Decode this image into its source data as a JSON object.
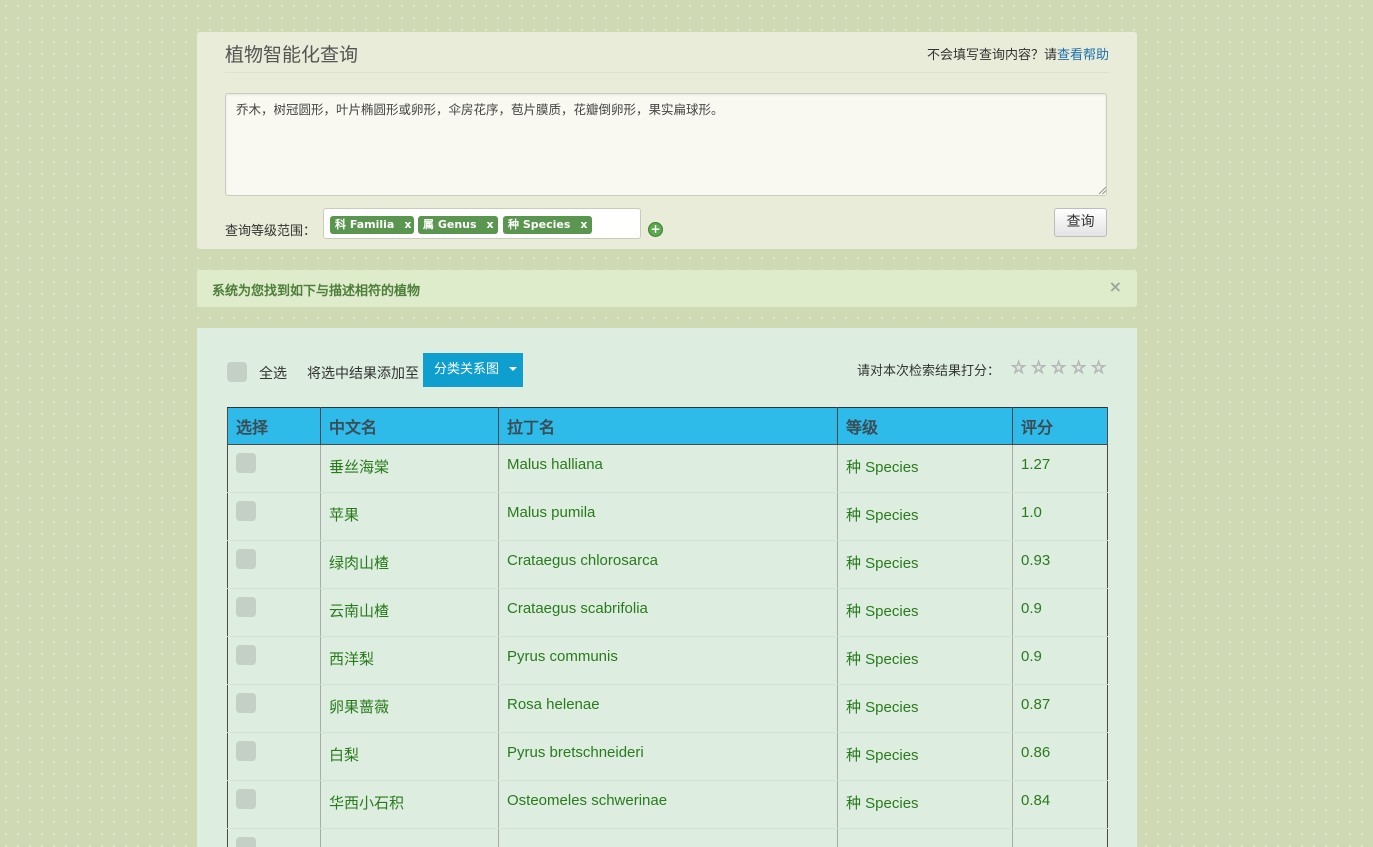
{
  "query": {
    "title": "植物智能化查询",
    "help_prefix": "不会填写查询内容？请",
    "help_link": "查看帮助",
    "description": "乔木，树冠圆形，叶片椭圆形或卵形，伞房花序，苞片膜质，花瓣倒卵形，果实扁球形。",
    "scope_label": "查询等级范围：",
    "tags": [
      {
        "label": "科 Familia",
        "remove": "x"
      },
      {
        "label": "属 Genus",
        "remove": "x"
      },
      {
        "label": "种 Species",
        "remove": "x"
      }
    ],
    "add_icon": "+",
    "submit_label": "查询"
  },
  "alert": {
    "text": "系统为您找到如下与描述相符的植物",
    "close": "×"
  },
  "results": {
    "select_all_label": "全选",
    "add_to_label": "将选中结果添加至",
    "dropdown_label": "分类关系图",
    "rate_label": "请对本次检索结果打分：",
    "stars": [
      "☆",
      "☆",
      "☆",
      "☆",
      "☆"
    ],
    "rating_value": 0,
    "columns": [
      "选择",
      "中文名",
      "拉丁名",
      "等级",
      "评分"
    ],
    "rows": [
      {
        "cn": "垂丝海棠",
        "latin": "Malus halliana",
        "rank": "种 Species",
        "score": "1.27"
      },
      {
        "cn": "苹果",
        "latin": "Malus pumila",
        "rank": "种 Species",
        "score": "1.0"
      },
      {
        "cn": "绿肉山楂",
        "latin": "Crataegus chlorosarca",
        "rank": "种 Species",
        "score": "0.93"
      },
      {
        "cn": "云南山楂",
        "latin": "Crataegus scabrifolia",
        "rank": "种 Species",
        "score": "0.9"
      },
      {
        "cn": "西洋梨",
        "latin": "Pyrus communis",
        "rank": "种 Species",
        "score": "0.9"
      },
      {
        "cn": "卵果蔷薇",
        "latin": "Rosa helenae",
        "rank": "种 Species",
        "score": "0.87"
      },
      {
        "cn": "白梨",
        "latin": "Pyrus bretschneideri",
        "rank": "种 Species",
        "score": "0.86"
      },
      {
        "cn": "华西小石积",
        "latin": "Osteomeles schwerinae",
        "rank": "种 Species",
        "score": "0.84"
      },
      {
        "cn": "",
        "latin": "",
        "rank": "",
        "score": ""
      }
    ]
  },
  "colors": {
    "background": "#cfd9b4",
    "header_blue": "#2ebbe9",
    "tag_green": "#5b9650",
    "link_blue": "#1e6fae",
    "result_text_green": "#2a7a1c",
    "dropdown_blue": "#0e9fcf"
  }
}
